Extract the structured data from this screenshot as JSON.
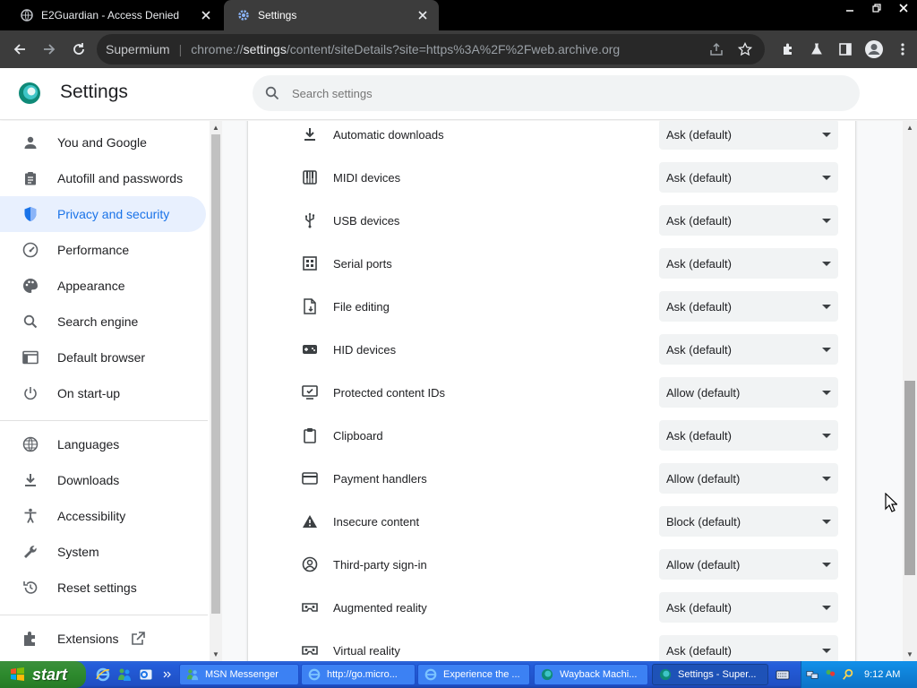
{
  "window": {
    "tabs": [
      {
        "title": "E2Guardian - Access Denied",
        "active": false
      },
      {
        "title": "Settings",
        "active": true
      }
    ]
  },
  "toolbar": {
    "brand": "Supermium",
    "url_prefix": "chrome://",
    "url_host": "settings",
    "url_rest": "/content/siteDetails?site=https%3A%2F%2Fweb.archive.org"
  },
  "header": {
    "title": "Settings",
    "search_placeholder": "Search settings"
  },
  "sidebar": {
    "items": [
      {
        "label": "You and Google",
        "icon": "person-icon"
      },
      {
        "label": "Autofill and passwords",
        "icon": "clipboard-icon"
      },
      {
        "label": "Privacy and security",
        "icon": "shield-icon",
        "active": true
      },
      {
        "label": "Performance",
        "icon": "speedometer-icon"
      },
      {
        "label": "Appearance",
        "icon": "palette-icon"
      },
      {
        "label": "Search engine",
        "icon": "search-icon"
      },
      {
        "label": "Default browser",
        "icon": "browser-icon"
      },
      {
        "label": "On start-up",
        "icon": "power-icon"
      }
    ],
    "items2": [
      {
        "label": "Languages",
        "icon": "globe-icon"
      },
      {
        "label": "Downloads",
        "icon": "download-icon"
      },
      {
        "label": "Accessibility",
        "icon": "accessibility-icon"
      },
      {
        "label": "System",
        "icon": "wrench-icon"
      },
      {
        "label": "Reset settings",
        "icon": "reset-icon"
      }
    ],
    "extensions": {
      "label": "Extensions",
      "icon": "puzzle-icon"
    }
  },
  "permissions": [
    {
      "label": "Automatic downloads",
      "value": "Ask (default)",
      "icon": "download-icon"
    },
    {
      "label": "MIDI devices",
      "value": "Ask (default)",
      "icon": "piano-icon"
    },
    {
      "label": "USB devices",
      "value": "Ask (default)",
      "icon": "usb-icon"
    },
    {
      "label": "Serial ports",
      "value": "Ask (default)",
      "icon": "serial-port-icon"
    },
    {
      "label": "File editing",
      "value": "Ask (default)",
      "icon": "file-edit-icon"
    },
    {
      "label": "HID devices",
      "value": "Ask (default)",
      "icon": "gamepad-icon"
    },
    {
      "label": "Protected content IDs",
      "value": "Allow (default)",
      "icon": "protected-content-icon"
    },
    {
      "label": "Clipboard",
      "value": "Ask (default)",
      "icon": "clipboard-icon"
    },
    {
      "label": "Payment handlers",
      "value": "Allow (default)",
      "icon": "credit-card-icon"
    },
    {
      "label": "Insecure content",
      "value": "Block (default)",
      "icon": "warning-icon"
    },
    {
      "label": "Third-party sign-in",
      "value": "Allow (default)",
      "icon": "account-circle-icon"
    },
    {
      "label": "Augmented reality",
      "value": "Ask (default)",
      "icon": "ar-icon"
    },
    {
      "label": "Virtual reality",
      "value": "Ask (default)",
      "icon": "vr-icon"
    }
  ],
  "taskbar": {
    "start_label": "start",
    "tasks": [
      {
        "title": "MSN Messenger",
        "active": false
      },
      {
        "title": "http://go.micro...",
        "active": false
      },
      {
        "title": "Experience the ...",
        "active": false
      },
      {
        "title": "Wayback Machi...",
        "active": false
      },
      {
        "title": "Settings - Super...",
        "active": true
      }
    ],
    "clock": "9:12 AM"
  },
  "colors": {
    "accent": "#1a73e8",
    "active_bg": "#e8f0fe"
  }
}
